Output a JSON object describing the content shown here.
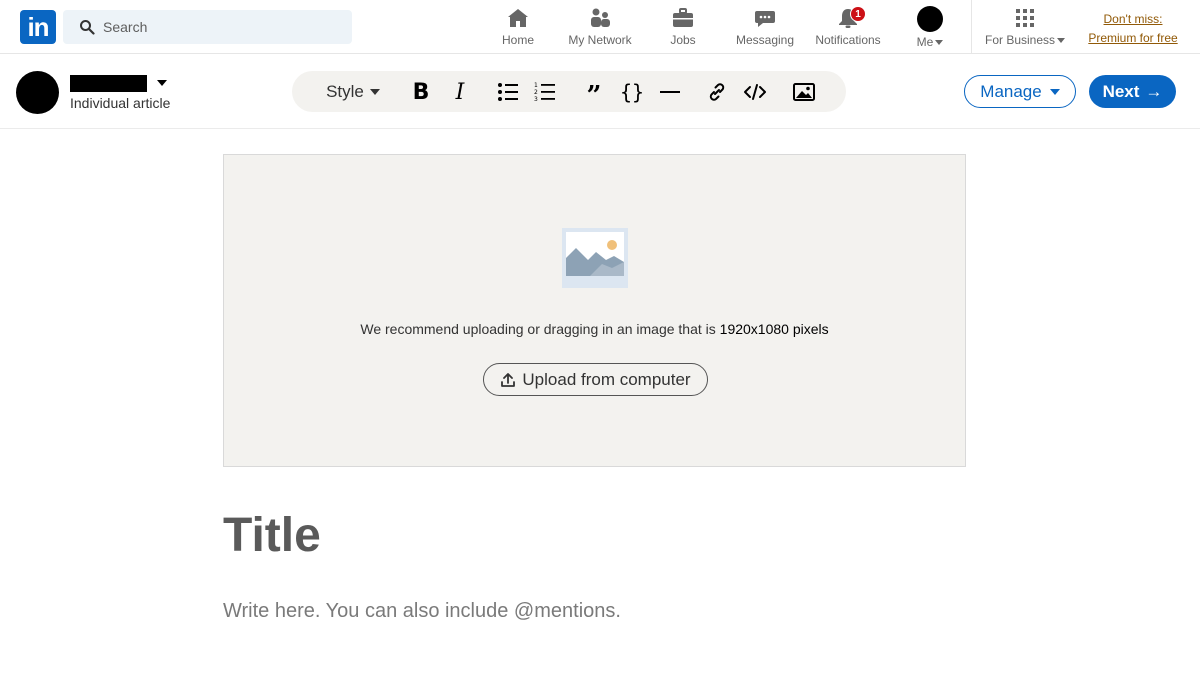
{
  "app": {
    "logo_text": "in",
    "brand_color": "#0a66c2"
  },
  "search": {
    "placeholder": "Search",
    "value": ""
  },
  "nav": {
    "home": {
      "label": "Home",
      "icon": "home-icon"
    },
    "network": {
      "label": "My Network",
      "icon": "people-icon"
    },
    "jobs": {
      "label": "Jobs",
      "icon": "briefcase-icon"
    },
    "messaging": {
      "label": "Messaging",
      "icon": "chat-bubble-icon"
    },
    "notifications": {
      "label": "Notifications",
      "icon": "bell-icon",
      "badge_count": "1",
      "badge_color": "#cc1016"
    },
    "me": {
      "label": "Me",
      "icon": "avatar"
    },
    "business": {
      "label": "For Business",
      "icon": "grid-icon"
    },
    "premium": {
      "line1": "Don't miss:",
      "line2": "Premium for free",
      "color": "#915907"
    }
  },
  "editor": {
    "author_subtitle": "Individual article",
    "toolbar": {
      "style_label": "Style",
      "bold_glyph": "B",
      "italic_glyph": "I",
      "quote_glyph": "”",
      "code_glyph": "{}",
      "icons": [
        "bold-icon",
        "italic-icon",
        "bulleted-list-icon",
        "numbered-list-icon",
        "quote-icon",
        "code-block-icon",
        "divider-icon",
        "link-icon",
        "embed-icon",
        "image-icon"
      ]
    },
    "manage_label": "Manage",
    "next_label": "Next",
    "next_arrow": "→"
  },
  "cover": {
    "hint_prefix": "We recommend uploading or dragging in an image that is ",
    "hint_size": "1920x1080 pixels",
    "upload_label": "Upload from computer",
    "background_color": "#f3f2ef"
  },
  "article": {
    "title_placeholder": "Title",
    "body_placeholder": "Write here. You can also include @mentions."
  }
}
